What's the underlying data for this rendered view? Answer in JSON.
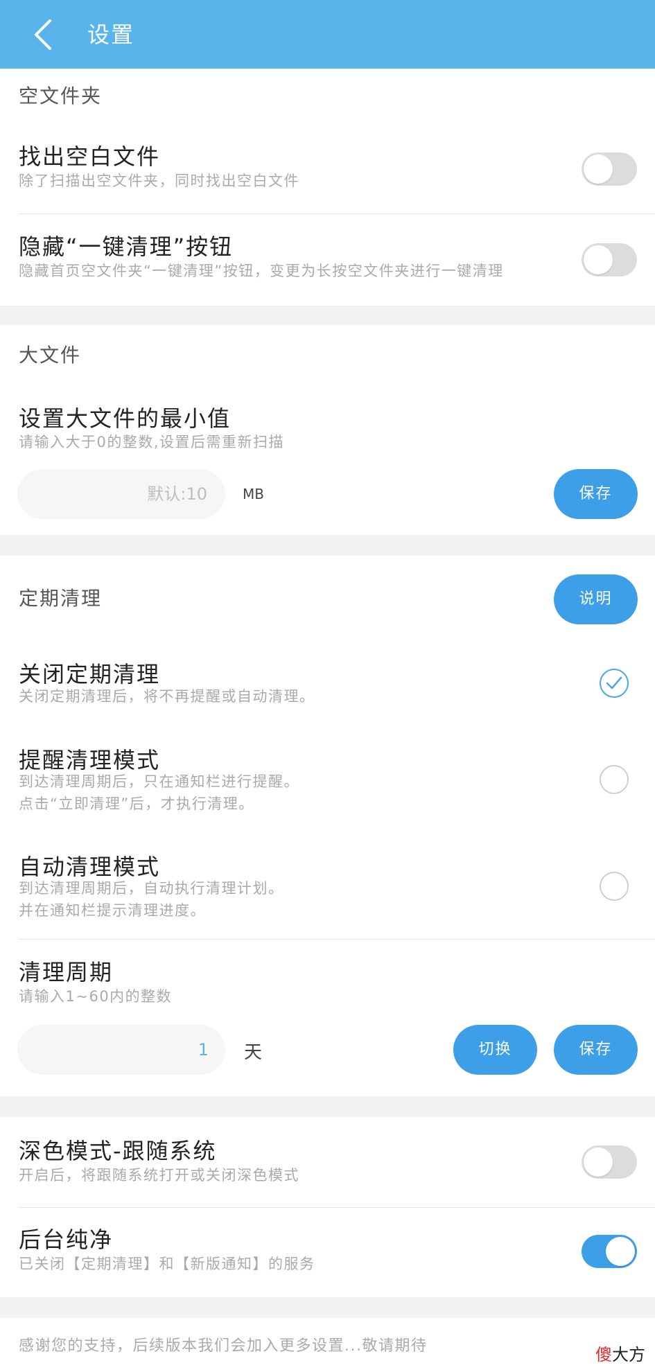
{
  "header": {
    "title": "设置",
    "back_icon": "chevron-left-icon"
  },
  "empty_folder": {
    "section_title": "空文件夹",
    "find_blank": {
      "title": "找出空白文件",
      "desc": "除了扫描出空文件夹，同时找出空白文件",
      "enabled": false
    },
    "hide_button": {
      "title": "隐藏“一键清理”按钮",
      "desc": "隐藏首页空文件夹“一键清理”按钮，变更为长按空文件夹进行一键清理",
      "enabled": false
    }
  },
  "large_file": {
    "section_title": "大文件",
    "min_size": {
      "title": "设置大文件的最小值",
      "desc": "请输入大于0的整数,设置后需重新扫描",
      "placeholder": "默认:10",
      "unit": "MB",
      "save_label": "保存"
    }
  },
  "scheduled_clean": {
    "section_title": "定期清理",
    "explain_label": "说明",
    "options": [
      {
        "title": "关闭定期清理",
        "desc": [
          "关闭定期清理后，将不再提醒或自动清理。"
        ],
        "checked": true
      },
      {
        "title": "提醒清理模式",
        "desc": [
          "到达清理周期后，只在通知栏进行提醒。",
          "点击“立即清理”后，才执行清理。"
        ],
        "checked": false
      },
      {
        "title": "自动清理模式",
        "desc": [
          "到达清理周期后，自动执行清理计划。",
          "并在通知栏提示清理进度。"
        ],
        "checked": false
      }
    ],
    "period": {
      "title": "清理周期",
      "desc": "请输入1~60内的整数",
      "value": "1",
      "unit": "天",
      "switch_label": "切换",
      "save_label": "保存"
    }
  },
  "other": {
    "dark_mode": {
      "title": "深色模式-跟随系统",
      "desc": "开启后，将跟随系统打开或关闭深色模式",
      "enabled": false
    },
    "background_clean": {
      "title": "后台纯净",
      "desc": "已关闭【定期清理】和【新版通知】的服务",
      "enabled": true
    }
  },
  "footer": {
    "text": "感谢您的支持，后续版本我们会加入更多设置...敬请期待"
  },
  "watermark": {
    "red_char": "傻",
    "rest": "大方"
  },
  "colors": {
    "primary": "#5ab4ec",
    "button": "#3d9fe8",
    "toggle_off": "#dcdcdc"
  }
}
